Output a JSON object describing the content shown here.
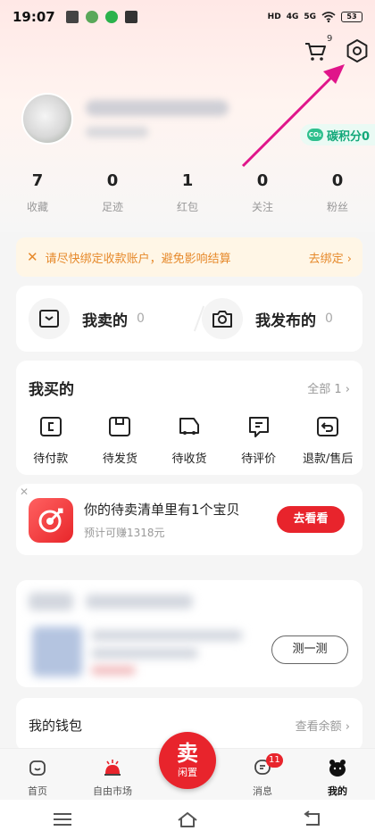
{
  "status": {
    "time": "19:07",
    "battery": "53",
    "net1": "4G",
    "net2": "5G",
    "hd": "HD"
  },
  "header": {
    "cart_count": "9"
  },
  "profile": {
    "carbon_label": "碳积分0"
  },
  "stats": [
    {
      "num": "7",
      "label": "收藏"
    },
    {
      "num": "0",
      "label": "足迹"
    },
    {
      "num": "1",
      "label": "红包"
    },
    {
      "num": "0",
      "label": "关注"
    },
    {
      "num": "0",
      "label": "粉丝"
    }
  ],
  "banner": {
    "close": "✕",
    "text": "请尽快绑定收款账户，避免影响结算",
    "action": "去绑定 ›"
  },
  "sell": {
    "sold_label": "我卖的",
    "sold_count": "0",
    "published_label": "我发布的",
    "published_count": "0"
  },
  "bought": {
    "title": "我买的",
    "all_label": "全部 1 ›",
    "orders": [
      "待付款",
      "待发货",
      "待收货",
      "待评价",
      "退款/售后"
    ]
  },
  "pending": {
    "close": "✕",
    "title": "你的待卖清单里有1个宝贝",
    "subtitle": "预计可赚1318元",
    "button": "去看看"
  },
  "test_button": "测一测",
  "wallet": {
    "title": "我的钱包",
    "action": "查看余额 ›"
  },
  "tabs": [
    {
      "label": "首页"
    },
    {
      "label": "自由市场"
    },
    {
      "label": ""
    },
    {
      "label": "消息",
      "badge": "11"
    },
    {
      "label": "我的"
    }
  ],
  "sell_button": {
    "big": "卖",
    "small": "闲置"
  },
  "colors": {
    "accent": "#e8242c",
    "carbon": "#13a87a",
    "banner": "#e6892b",
    "arrow": "#e0158a"
  }
}
